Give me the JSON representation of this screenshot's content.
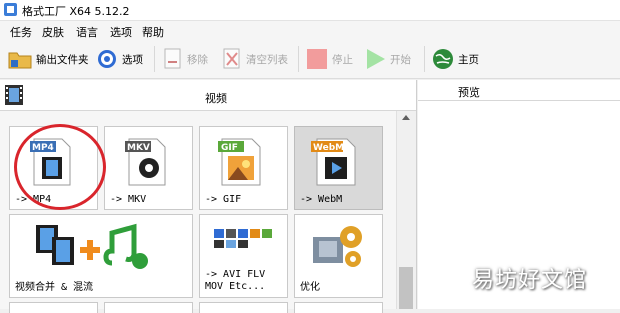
{
  "window": {
    "title": "格式工厂 X64 5.12.2"
  },
  "menu": [
    "任务",
    "皮肤",
    "语言",
    "选项",
    "帮助"
  ],
  "toolbar": {
    "output_folder": "输出文件夹",
    "options": "选项",
    "remove": "移除",
    "clear_list": "清空列表",
    "stop": "停止",
    "start": "开始",
    "home": "主页"
  },
  "category": {
    "label": "视频"
  },
  "tiles": [
    {
      "label": "-> MP4",
      "badge": "MP4",
      "badge_color": "#3a6fb5"
    },
    {
      "label": "-> MKV",
      "badge": "MKV",
      "badge_color": "#555555"
    },
    {
      "label": "-> GIF",
      "badge": "GIF",
      "badge_color": "#5aa83a"
    },
    {
      "label": "-> WebM",
      "badge": "WebM",
      "badge_color": "#e28a16"
    },
    {
      "label": "视频合并 & 混流"
    },
    {
      "label": "-> AVI FLV\nMOV Etc..."
    },
    {
      "label": "优化"
    }
  ],
  "preview": {
    "label": "预览"
  },
  "watermark": "易坊好文馆",
  "colors": {
    "highlight_circle": "#d9252c",
    "selected_tile": "#d9d9d9"
  }
}
